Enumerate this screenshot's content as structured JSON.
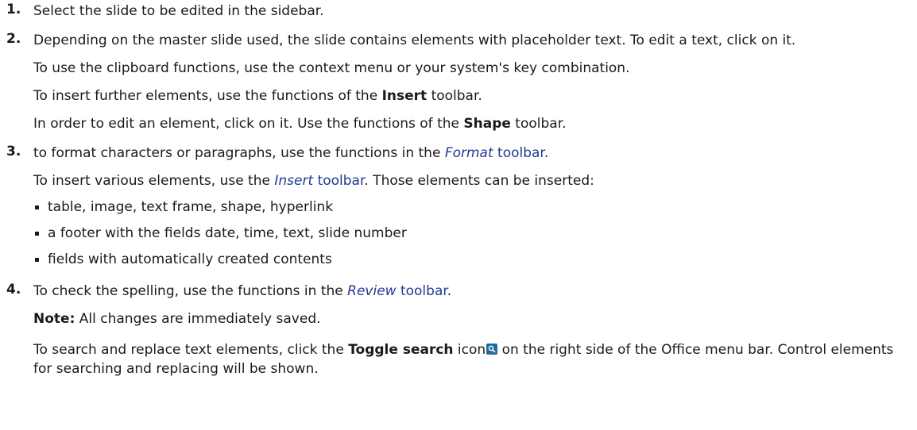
{
  "steps": [
    {
      "num": "1.",
      "text": "Select the slide to be edited in the sidebar."
    },
    {
      "num": "2.",
      "para1": "Depending on the master slide used, the slide contains elements with placeholder text. To edit a text, click on it.",
      "para2": "To use the clipboard functions, use the context menu or your system's key combination.",
      "para3_pre": "To insert further elements, use the functions of the ",
      "para3_bold": "Insert",
      "para3_post": " toolbar.",
      "para4_pre": "In order to edit an element, click on it. Use the functions of the ",
      "para4_bold": "Shape",
      "para4_post": " toolbar."
    },
    {
      "num": "3.",
      "para1_pre": "to format characters or paragraphs, use the functions in the ",
      "para1_link_italic": "Format",
      "para1_link_rest": " toolbar",
      "para1_post": ".",
      "para2_pre": "To insert various elements, use the ",
      "para2_link_italic": "Insert",
      "para2_link_rest": " toolbar",
      "para2_post": ". Those elements can be inserted:",
      "bullets": [
        "table, image, text frame, shape, hyperlink",
        "a footer with the fields date, time, text, slide number",
        "fields with automatically created contents"
      ]
    },
    {
      "num": "4.",
      "para1_pre": "To check the spelling, use the functions in the ",
      "para1_link_italic": "Review",
      "para1_link_rest": " toolbar",
      "para1_post": ".",
      "note_label": "Note:",
      "note_text": " All changes are immediately saved.",
      "para3_pre": "To search and replace text elements, click the ",
      "para3_bold": "Toggle search",
      "para3_mid": " icon",
      "para3_post": " on the right side of the Office menu bar. Control elements for searching and replacing will be shown."
    }
  ],
  "icons": {
    "toggle_search": "search-icon"
  },
  "colors": {
    "link": "#1f3a93",
    "icon_bg": "#1f6b9e",
    "text": "#1a1a1a"
  }
}
